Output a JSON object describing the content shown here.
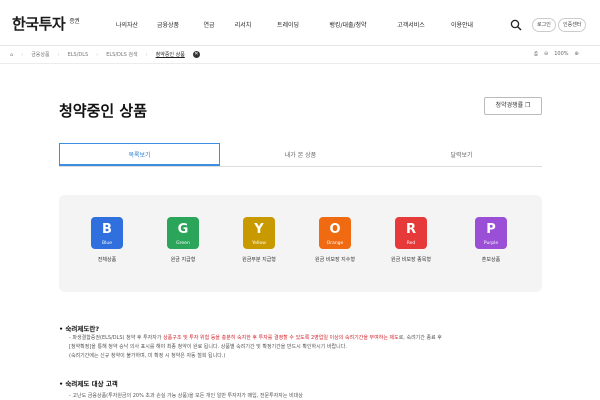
{
  "header": {
    "logo": "한국투자",
    "logo_sub": "증권",
    "nav": [
      "나의자산",
      "금융상품",
      "연금",
      "리서치",
      "트레이딩",
      "뱅킹/대출/청약",
      "고객서비스",
      "이용안내"
    ],
    "login": "로그인",
    "cert": "인증센터"
  },
  "breadcrumb": {
    "home": "⌂",
    "items": [
      "금융상품",
      "ELS/DLS",
      "ELS/DLS 검색",
      "청약중인 상품"
    ],
    "close": "✕",
    "zoom": "100%",
    "print": "⎙",
    "zoom_out": "⊖",
    "zoom_in": "⊕"
  },
  "page": {
    "title": "청약중인 상품",
    "history_button": "청약경쟁률 ❐"
  },
  "tabs": [
    "목록보기",
    "내가 본 상품",
    "달력보기"
  ],
  "categories": [
    {
      "letter": "B",
      "word": "Blue",
      "label": "전체상품",
      "color": "#2f6fde"
    },
    {
      "letter": "G",
      "word": "Green",
      "label": "원금 지급형",
      "color": "#2aa55a"
    },
    {
      "letter": "Y",
      "word": "Yellow",
      "label": "원금부분 지급형",
      "color": "#c99a00"
    },
    {
      "letter": "O",
      "word": "Orange",
      "label": "원금 비보장 지수형",
      "color": "#ef6a11"
    },
    {
      "letter": "R",
      "word": "Red",
      "label": "원금 비보장 종목형",
      "color": "#e5393a"
    },
    {
      "letter": "P",
      "word": "Purple",
      "label": "혼보상품",
      "color": "#9a4fd6"
    }
  ],
  "notes": {
    "section1_title": "숙려제도란?",
    "section1_p1_a": "- 파생결합증권(ELS/DLS) 청약 후 투자자가 ",
    "section1_p1_hl": "상품구조 및 투자 위험 등을 충분히 숙지한 후 투자를 결정할 수 있도록 2영업일 이상의 숙려기간을 부여하는 제도",
    "section1_p1_b": "로, 숙려기간 종료 후",
    "section1_p2": "[청약확정]을 통해 청약 승낙 의사 표시를 해야 최종 청약이 완료 됩니다.  상품별 숙려기간 및 확정기간을 반드시 확인하시기 바랍니다.",
    "section1_p3": "(숙려기간에는 신규 청약이 불가하며, 미 확정 시 청약은 자동 철회 됩니다.)",
    "section2_title": "숙려제도 대상 고객",
    "section2_p1": "- 고난도 금융상품(투자원금의 20% 초과 손실 가능 상품)을 모든 개인 일반 투자자가 매입, 전문투자자는 비대상"
  }
}
